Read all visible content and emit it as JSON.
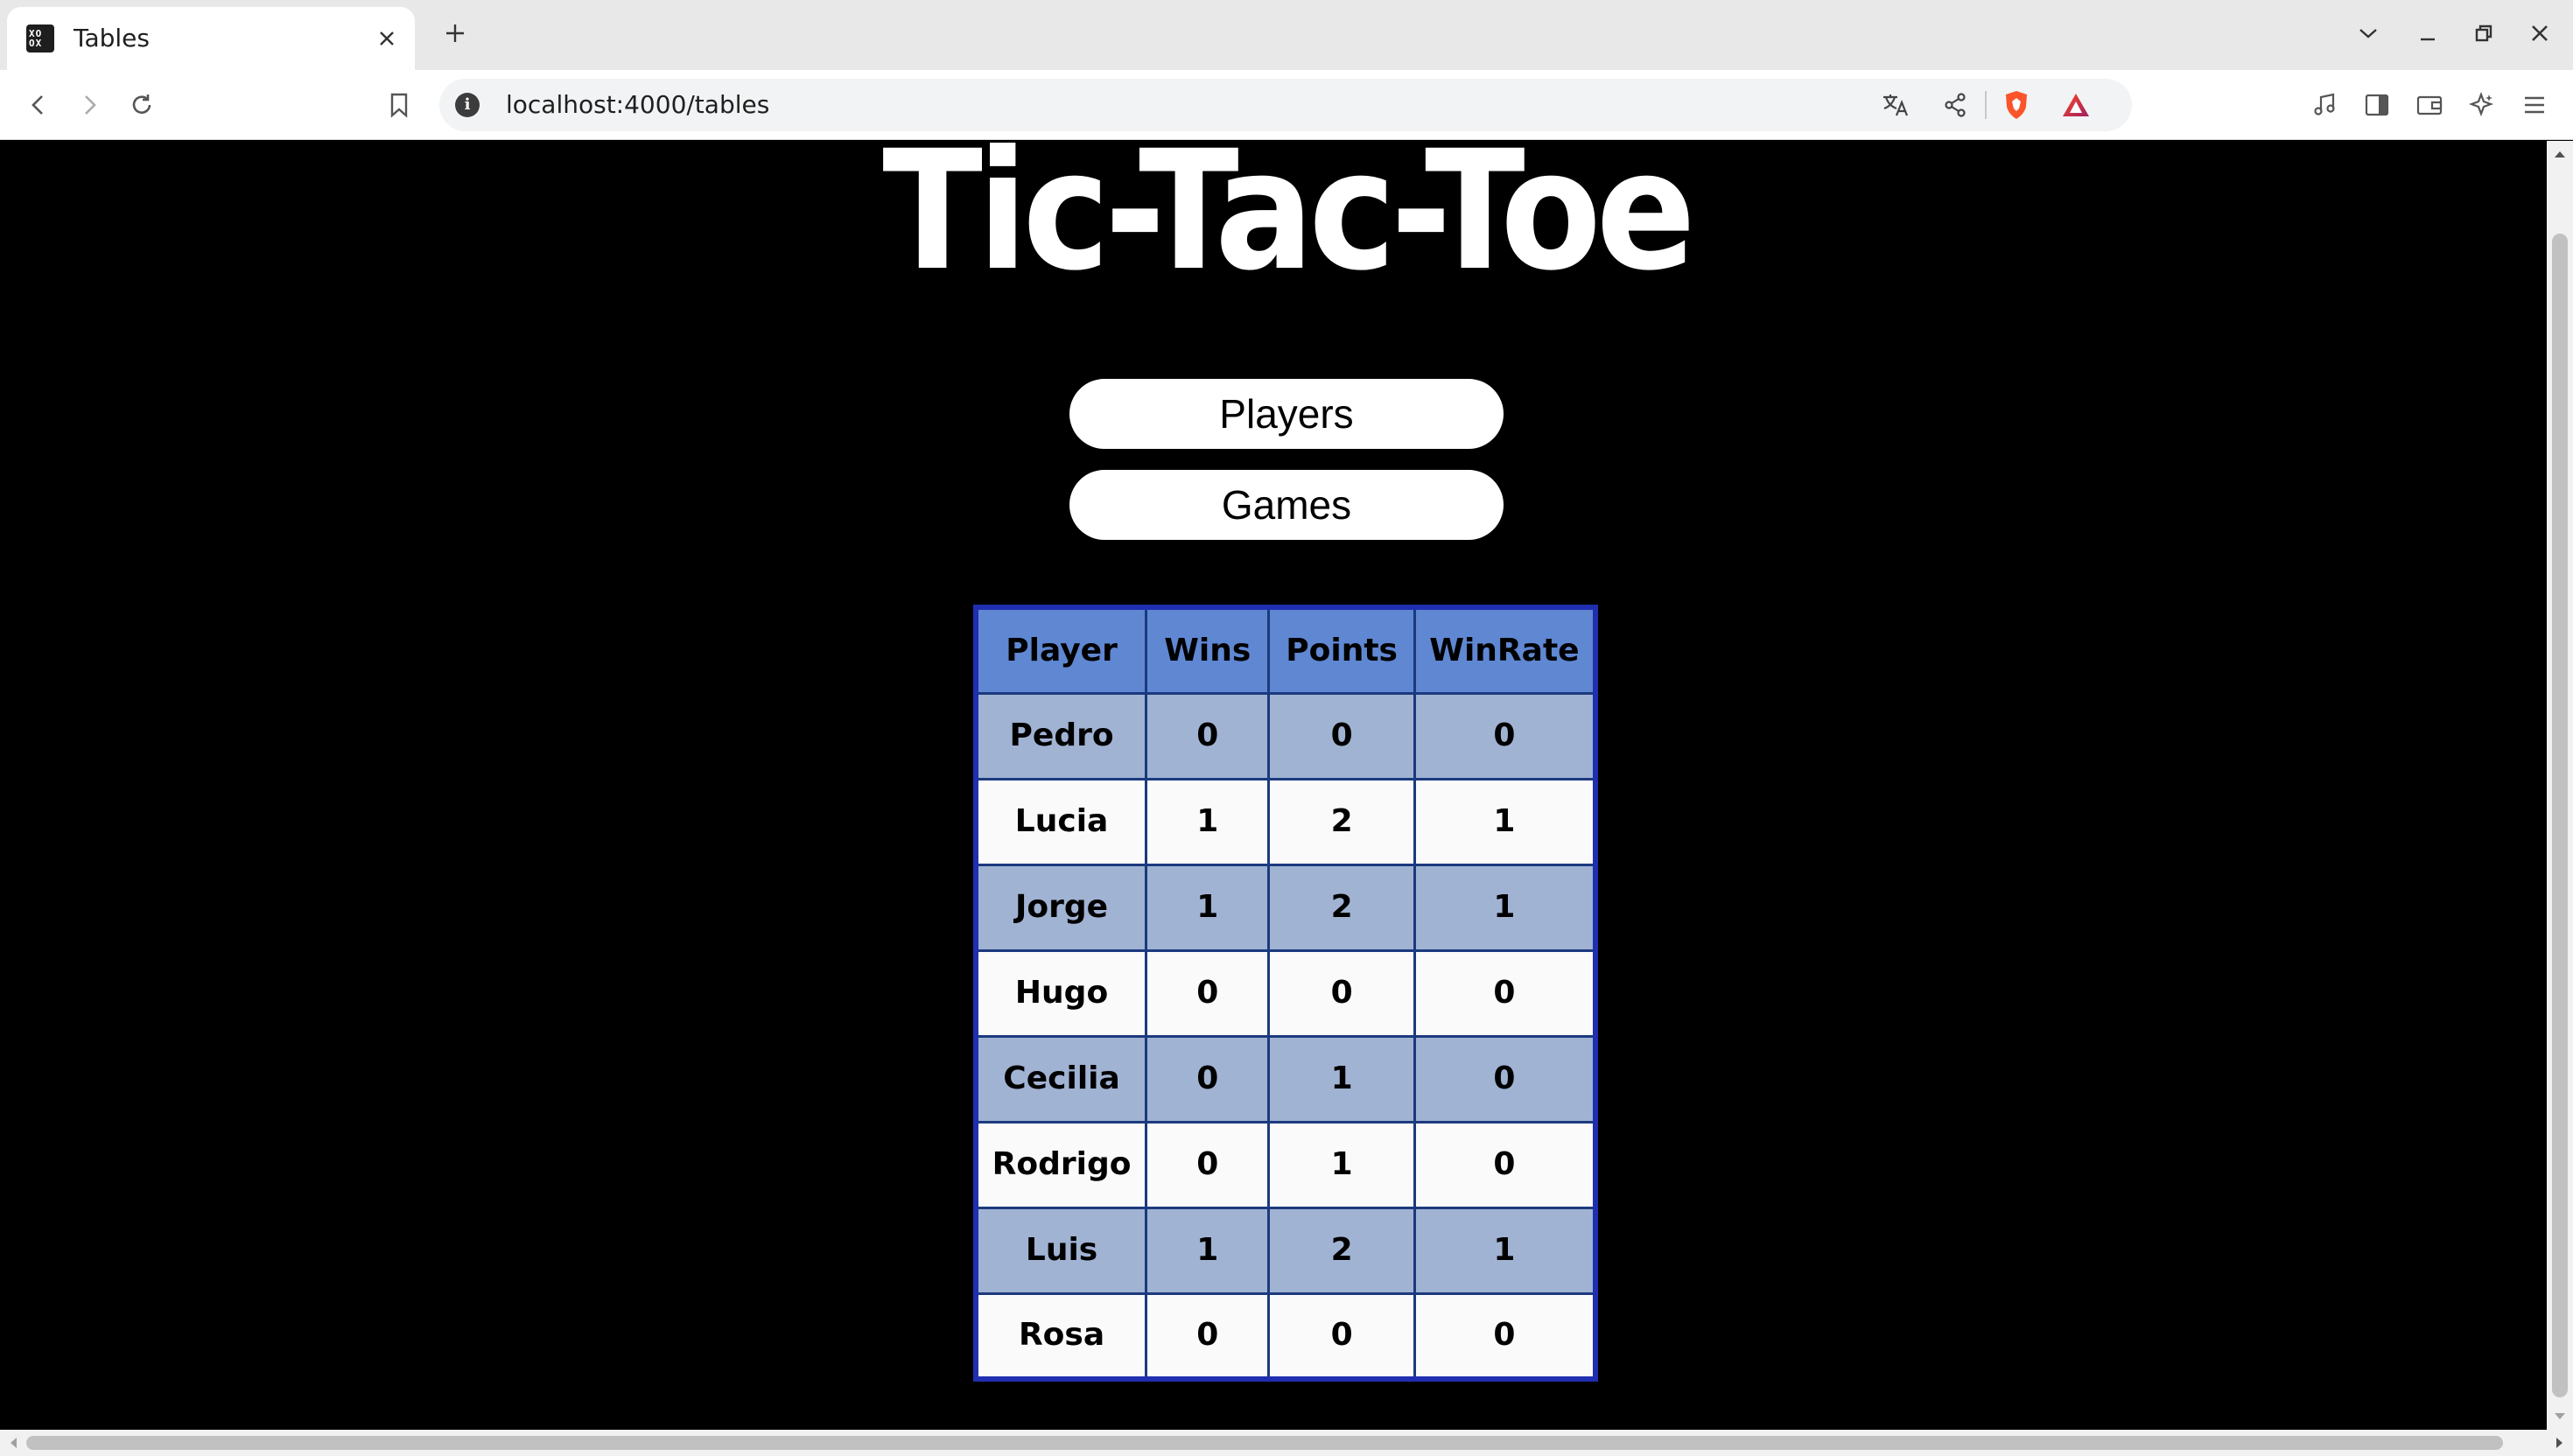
{
  "browser": {
    "tab_title": "Tables",
    "favicon_text": "XO OX",
    "url": "localhost:4000/tables"
  },
  "page": {
    "title": "Tic-Tac-Toe",
    "buttons": {
      "players": "Players",
      "games": "Games"
    },
    "table": {
      "headers": [
        "Player",
        "Wins",
        "Points",
        "WinRate"
      ],
      "rows": [
        {
          "player": "Pedro",
          "wins": "0",
          "points": "0",
          "winrate": "0"
        },
        {
          "player": "Lucia",
          "wins": "1",
          "points": "2",
          "winrate": "1"
        },
        {
          "player": "Jorge",
          "wins": "1",
          "points": "2",
          "winrate": "1"
        },
        {
          "player": "Hugo",
          "wins": "0",
          "points": "0",
          "winrate": "0"
        },
        {
          "player": "Cecilia",
          "wins": "0",
          "points": "1",
          "winrate": "0"
        },
        {
          "player": "Rodrigo",
          "wins": "0",
          "points": "1",
          "winrate": "0"
        },
        {
          "player": "Luis",
          "wins": "1",
          "points": "2",
          "winrate": "1"
        },
        {
          "player": "Rosa",
          "wins": "0",
          "points": "0",
          "winrate": "0"
        }
      ]
    }
  },
  "colors": {
    "page_background": "#000000",
    "header_cell": "#5f87d2",
    "odd_row": "#a1b3d3",
    "even_row": "#fafafa",
    "table_border": "#1f2fb0",
    "brave_orange": "#fb542b"
  },
  "icons": {
    "toolbar": [
      "back-icon",
      "forward-icon",
      "reload-icon",
      "bookmark-icon"
    ],
    "omnibox": [
      "site-info-icon",
      "translate-icon",
      "share-icon",
      "brave-shields-icon",
      "brave-rewards-icon"
    ],
    "right": [
      "media-icon",
      "sidebar-icon",
      "wallet-icon",
      "leo-ai-icon",
      "menu-icon"
    ]
  }
}
